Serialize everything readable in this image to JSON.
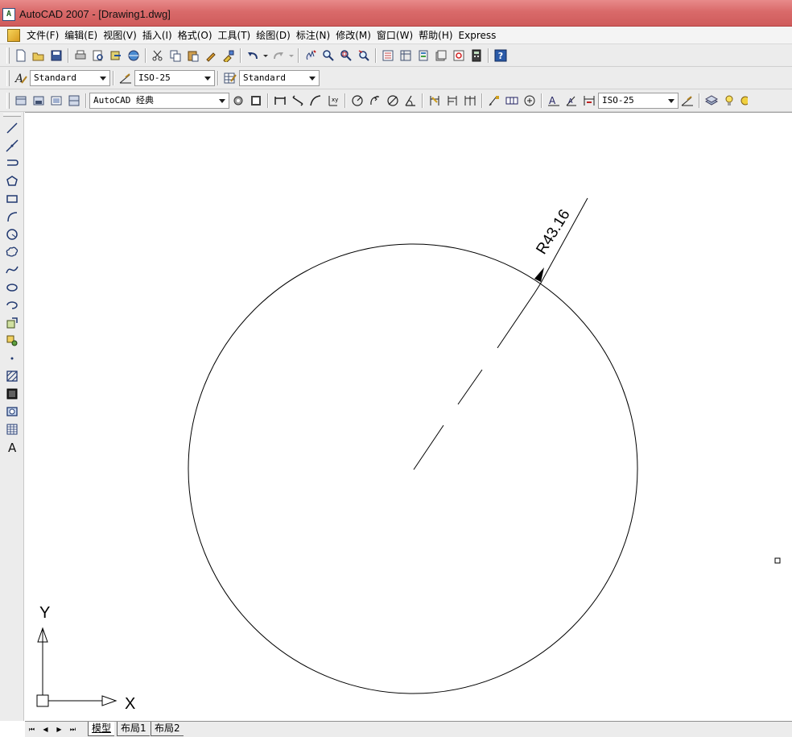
{
  "window": {
    "title": "AutoCAD 2007 - [Drawing1.dwg]",
    "app_icon_text": "A"
  },
  "menubar": {
    "items": [
      "文件(F)",
      "编辑(E)",
      "视图(V)",
      "插入(I)",
      "格式(O)",
      "工具(T)",
      "绘图(D)",
      "标注(N)",
      "修改(M)",
      "窗口(W)",
      "帮助(H)",
      "Express"
    ]
  },
  "styles_toolbar": {
    "text_style": "Standard",
    "dim_style": "ISO-25",
    "table_style": "Standard"
  },
  "layers_toolbar": {
    "workspace": "AutoCAD 经典",
    "dim_style": "ISO-25"
  },
  "icons": {
    "standard": [
      "new-icon",
      "open-icon",
      "save-icon",
      "plot-icon",
      "plot-preview-icon",
      "publish-icon",
      "3d-dwf-icon",
      "cut-icon",
      "copy-icon",
      "paste-icon",
      "match-properties-icon",
      "block-editor-icon",
      "undo-icon",
      "redo-icon",
      "pan-icon",
      "zoom-realtime-icon",
      "zoom-window-icon",
      "zoom-previous-icon",
      "properties-icon",
      "design-center-icon",
      "tool-palettes-icon",
      "sheet-set-icon",
      "markup-icon",
      "calculator-icon",
      "help-icon"
    ],
    "draw": [
      "line-icon",
      "construction-line-icon",
      "polyline-icon",
      "polygon-icon",
      "rectangle-icon",
      "arc-icon",
      "circle-icon",
      "revision-cloud-icon",
      "spline-icon",
      "ellipse-icon",
      "ellipse-arc-icon",
      "insert-block-icon",
      "make-block-icon",
      "point-icon",
      "hatch-icon",
      "gradient-icon",
      "region-icon",
      "table-icon",
      "multiline-text-icon"
    ]
  },
  "drawing": {
    "dimension_text": "R43.16",
    "ucs": {
      "x_label": "X",
      "y_label": "Y"
    }
  },
  "layout_tabs": {
    "tabs": [
      "模型",
      "布局1",
      "布局2"
    ],
    "active": 0
  },
  "colors": {
    "titlebar": "#d96a6a",
    "toolbar_bg": "#ececec",
    "canvas_bg": "#ffffff",
    "geometry": "#000000"
  }
}
